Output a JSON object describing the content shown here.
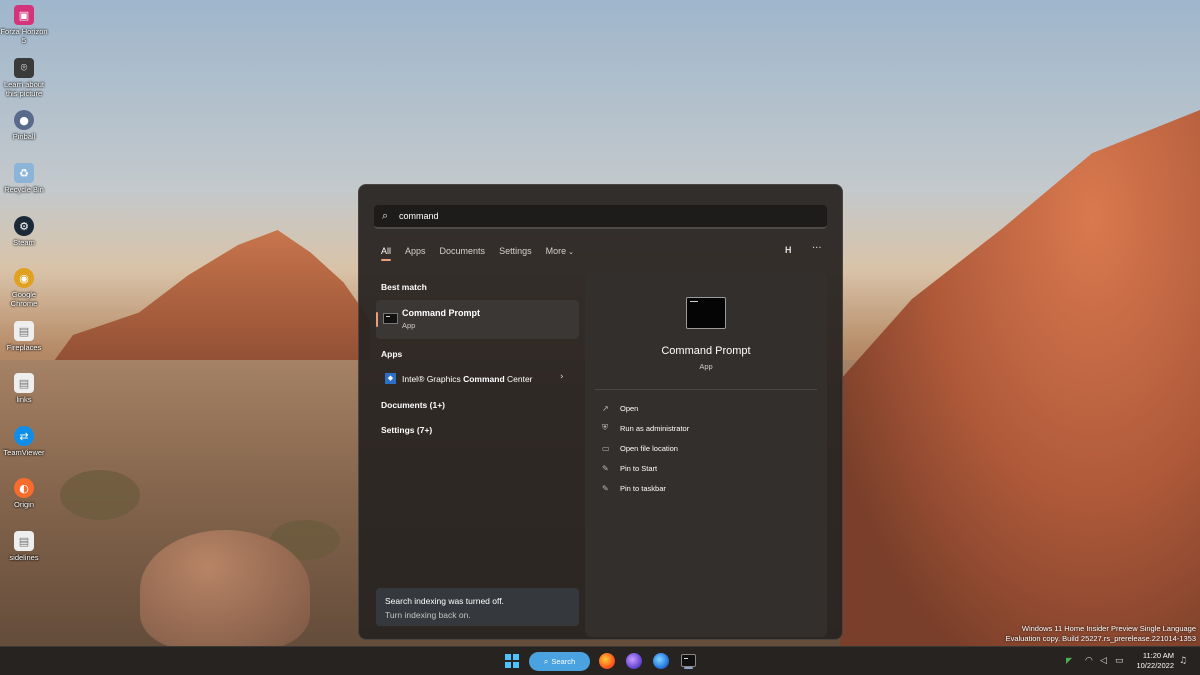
{
  "desktop": {
    "icons": [
      {
        "label": "Forza Horizon 5",
        "glyph": "▣",
        "color": "#d4357a"
      },
      {
        "label": "Learn about this picture",
        "glyph": "⌾",
        "color": "#3a3a3a"
      },
      {
        "label": "Pinball",
        "glyph": "●",
        "color": "#5a6a8a"
      },
      {
        "label": "Recycle Bin",
        "glyph": "♻",
        "color": "#8cb4d8"
      },
      {
        "label": "Steam",
        "glyph": "⚙",
        "color": "#1b2838"
      },
      {
        "label": "Google Chrome",
        "glyph": "◉",
        "color": "#e0a020"
      },
      {
        "label": "Fireplaces",
        "glyph": "▤",
        "color": "#eeeeee"
      },
      {
        "label": "links",
        "glyph": "▤",
        "color": "#eeeeee"
      },
      {
        "label": "TeamViewer",
        "glyph": "⇄",
        "color": "#0e8ee9"
      },
      {
        "label": "Origin",
        "glyph": "◐",
        "color": "#f56c2d"
      },
      {
        "label": "sidelines",
        "glyph": "▤",
        "color": "#eeeeee"
      }
    ]
  },
  "search": {
    "query": "command",
    "filters": [
      "All",
      "Apps",
      "Documents",
      "Settings",
      "More"
    ],
    "account_initial": "H",
    "more_options": "···"
  },
  "results": {
    "best_match_heading": "Best match",
    "best_match": {
      "title": "Command Prompt",
      "type": "App"
    },
    "apps_heading": "Apps",
    "app_item": {
      "prefix": "Intel® Graphics ",
      "highlight": "Command",
      "suffix": " Center"
    },
    "documents_heading": "Documents (1+)",
    "settings_heading": "Settings (7+)",
    "indexing_notice": {
      "title": "Search indexing was turned off.",
      "link": "Turn indexing back on."
    }
  },
  "detail": {
    "name": "Command Prompt",
    "type": "App",
    "actions": [
      {
        "label": "Open",
        "icon": "open-icon",
        "glyph": "↗"
      },
      {
        "label": "Run as administrator",
        "icon": "shield-icon",
        "glyph": "⛨"
      },
      {
        "label": "Open file location",
        "icon": "folder-icon",
        "glyph": "▭"
      },
      {
        "label": "Pin to Start",
        "icon": "pin-icon",
        "glyph": "✎"
      },
      {
        "label": "Pin to taskbar",
        "icon": "pin-icon",
        "glyph": "✎"
      }
    ]
  },
  "watermark": {
    "line1": "Windows 11 Home Insider Preview Single Language",
    "line2": "Evaluation copy. Build 25227.rs_prerelease.221014-1353"
  },
  "taskbar": {
    "search_label": "Search",
    "time": "11:20 AM",
    "date": "10/22/2022",
    "accent": "#4cc2ff"
  }
}
